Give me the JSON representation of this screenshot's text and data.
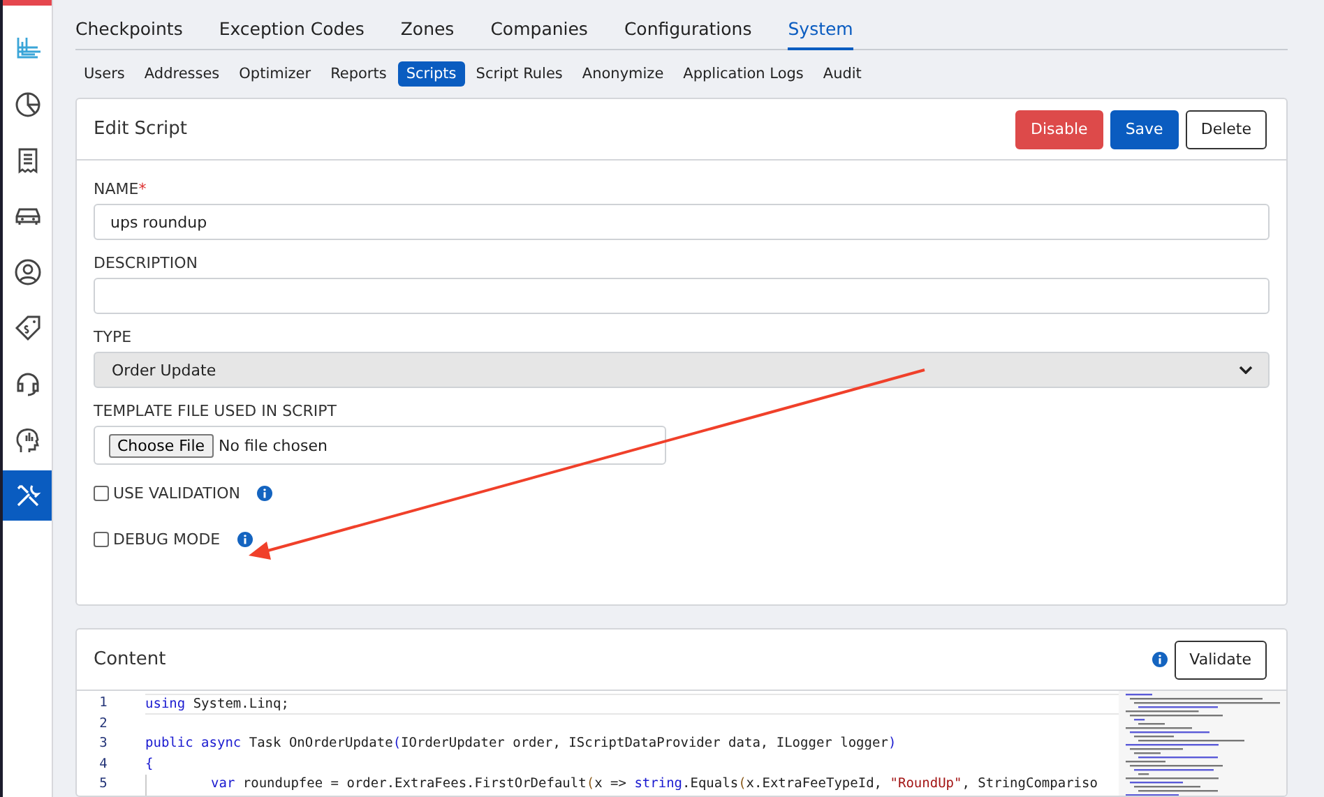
{
  "sidebar": {
    "items": [
      {
        "kind": "logo",
        "selected": false
      },
      {
        "kind": "pie",
        "selected": false
      },
      {
        "kind": "receipt",
        "selected": false
      },
      {
        "kind": "car",
        "selected": false
      },
      {
        "kind": "user",
        "selected": false
      },
      {
        "kind": "tag",
        "selected": false
      },
      {
        "kind": "headset",
        "selected": false
      },
      {
        "kind": "head",
        "selected": false
      },
      {
        "kind": "tools",
        "selected": true
      }
    ]
  },
  "tabs": [
    {
      "label": "Checkpoints",
      "selected": false
    },
    {
      "label": "Exception Codes",
      "selected": false
    },
    {
      "label": "Zones",
      "selected": false
    },
    {
      "label": "Companies",
      "selected": false
    },
    {
      "label": "Configurations",
      "selected": false
    },
    {
      "label": "System",
      "selected": true
    }
  ],
  "subtabs": [
    {
      "label": "Users",
      "selected": false
    },
    {
      "label": "Addresses",
      "selected": false
    },
    {
      "label": "Optimizer",
      "selected": false
    },
    {
      "label": "Reports",
      "selected": false
    },
    {
      "label": "Scripts",
      "selected": true
    },
    {
      "label": "Script Rules",
      "selected": false
    },
    {
      "label": "Anonymize",
      "selected": false
    },
    {
      "label": "Application Logs",
      "selected": false
    },
    {
      "label": "Audit",
      "selected": false
    }
  ],
  "edit_card": {
    "title": "Edit Script",
    "buttons": [
      {
        "label": "Disable",
        "kind": "danger"
      },
      {
        "label": "Save",
        "kind": "primary"
      },
      {
        "label": "Delete",
        "kind": "outline"
      }
    ],
    "fields": [
      {
        "kind": "text",
        "label": "NAME",
        "required_mark": "*",
        "value": "ups roundup"
      },
      {
        "kind": "text",
        "label": "DESCRIPTION"
      },
      {
        "kind": "select",
        "label": "TYPE",
        "value": "Order Update",
        "disabled": true
      },
      {
        "kind": "file",
        "label": "TEMPLATE FILE USED IN SCRIPT",
        "button": "Choose File",
        "value": "No file chosen"
      },
      {
        "kind": "checkbox",
        "label": "USE VALIDATION",
        "checked": false
      },
      {
        "kind": "checkbox",
        "label": "DEBUG MODE",
        "checked": false
      }
    ]
  },
  "content_card": {
    "title": "Content",
    "button": "Validate",
    "lines": [
      {
        "number": "1",
        "tokens": [
          {
            "kind": "keyword",
            "text": "using"
          },
          {
            "kind": "plain",
            "text": " System.Linq;"
          }
        ]
      },
      {
        "number": "2"
      },
      {
        "number": "3",
        "tokens": [
          {
            "kind": "keyword",
            "text": "public async"
          },
          {
            "kind": "plain",
            "text": " Task OnOrderUpdate"
          },
          {
            "kind": "keyword",
            "text": "("
          },
          {
            "kind": "plain",
            "text": "IOrderUpdater order, IScriptDataProvider data, ILogger logger"
          },
          {
            "kind": "keyword",
            "text": ")"
          }
        ]
      },
      {
        "number": "4",
        "tokens": [
          {
            "kind": "keyword",
            "text": "{"
          }
        ]
      },
      {
        "number": "5",
        "indent": true,
        "tokens": [
          {
            "kind": "keyword",
            "text": "var"
          },
          {
            "kind": "plain",
            "text": " roundupfee = order.ExtraFees.FirstOrDefault"
          },
          {
            "kind": "paren",
            "text": "("
          },
          {
            "kind": "plain",
            "text": "x => "
          },
          {
            "kind": "keyword",
            "text": "string"
          },
          {
            "kind": "plain",
            "text": ".Equals"
          },
          {
            "kind": "paren",
            "text": "("
          },
          {
            "kind": "plain",
            "text": "x.ExtraFeeTypeId, "
          },
          {
            "kind": "string",
            "text": "\"RoundUp\""
          },
          {
            "kind": "plain",
            "text": ", StringCompariso"
          }
        ]
      }
    ]
  }
}
